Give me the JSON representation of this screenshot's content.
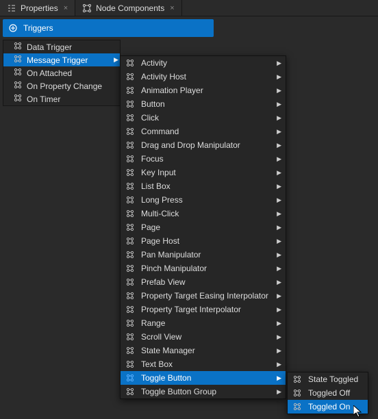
{
  "tabs": [
    {
      "label": "Properties",
      "icon": "properties-icon"
    },
    {
      "label": "Node Components",
      "icon": "components-icon"
    }
  ],
  "section": {
    "title": "Triggers"
  },
  "tree": [
    {
      "label": "Data Trigger"
    },
    {
      "label": "Message Trigger",
      "hovered": true,
      "submenu": true
    },
    {
      "label": "On Attached"
    },
    {
      "label": "On Property Change"
    },
    {
      "label": "On Timer"
    }
  ],
  "submenu1": [
    {
      "label": "Activity",
      "sub": true
    },
    {
      "label": "Activity Host",
      "sub": true
    },
    {
      "label": "Animation Player",
      "sub": true
    },
    {
      "label": "Button",
      "sub": true
    },
    {
      "label": "Click",
      "sub": true
    },
    {
      "label": "Command",
      "sub": true
    },
    {
      "label": "Drag and Drop Manipulator",
      "sub": true
    },
    {
      "label": "Focus",
      "sub": true
    },
    {
      "label": "Key Input",
      "sub": true
    },
    {
      "label": "List Box",
      "sub": true
    },
    {
      "label": "Long Press",
      "sub": true
    },
    {
      "label": "Multi-Click",
      "sub": true
    },
    {
      "label": "Page",
      "sub": true
    },
    {
      "label": "Page Host",
      "sub": true
    },
    {
      "label": "Pan Manipulator",
      "sub": true
    },
    {
      "label": "Pinch Manipulator",
      "sub": true
    },
    {
      "label": "Prefab View",
      "sub": true
    },
    {
      "label": "Property Target Easing Interpolator",
      "sub": true
    },
    {
      "label": "Property Target Interpolator",
      "sub": true
    },
    {
      "label": "Range",
      "sub": true
    },
    {
      "label": "Scroll View",
      "sub": true
    },
    {
      "label": "State Manager",
      "sub": true
    },
    {
      "label": "Text Box",
      "sub": true
    },
    {
      "label": "Toggle Button",
      "sub": true,
      "hovered": true
    },
    {
      "label": "Toggle Button Group",
      "sub": true
    }
  ],
  "submenu2": [
    {
      "label": "State Toggled"
    },
    {
      "label": "Toggled Off"
    },
    {
      "label": "Toggled On",
      "hovered": true
    }
  ]
}
